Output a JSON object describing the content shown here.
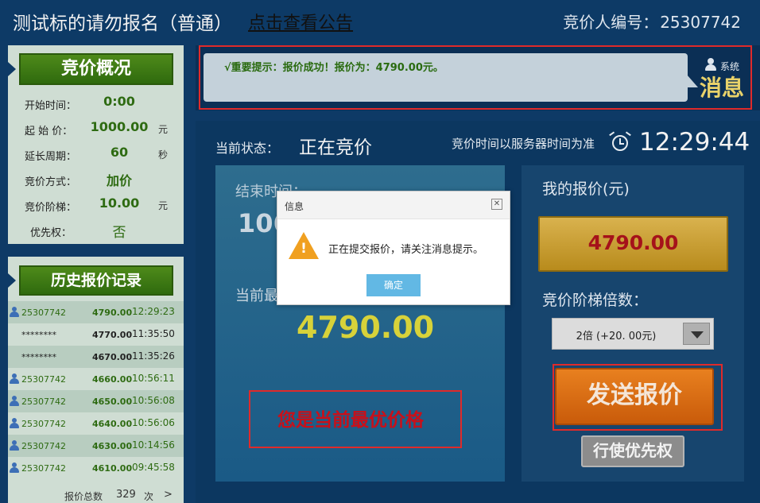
{
  "header": {
    "title": "测试标的请勿报名（普通）",
    "announcement_link": "点击查看公告",
    "bidder_label": "竞价人编号：",
    "bidder_id": "25307742"
  },
  "summary": {
    "title": "竞价概况",
    "rows": [
      {
        "label": "开始时间：",
        "value": "0:00",
        "unit": ""
      },
      {
        "label": "起 始 价：",
        "value": "1000.00",
        "unit": "元"
      },
      {
        "label": "延长周期：",
        "value": "60",
        "unit": "秒"
      },
      {
        "label": "竞价方式：",
        "value": "加价",
        "unit": ""
      },
      {
        "label": "竞价阶梯：",
        "value": "10.00",
        "unit": "元"
      },
      {
        "label": "优先权：",
        "value": "否",
        "unit": ""
      }
    ]
  },
  "history": {
    "title": "历史报价记录",
    "rows": [
      {
        "bidder": "25307742",
        "price": "4790.00",
        "time": "12:29:23",
        "is_user": true
      },
      {
        "bidder": "********",
        "price": "4770.00",
        "time": "11:35:50",
        "is_user": false
      },
      {
        "bidder": "********",
        "price": "4670.00",
        "time": "11:35:26",
        "is_user": false
      },
      {
        "bidder": "25307742",
        "price": "4660.00",
        "time": "10:56:11",
        "is_user": true
      },
      {
        "bidder": "25307742",
        "price": "4650.00",
        "time": "10:56:08",
        "is_user": true
      },
      {
        "bidder": "25307742",
        "price": "4640.00",
        "time": "10:56:06",
        "is_user": true
      },
      {
        "bidder": "25307742",
        "price": "4630.00",
        "time": "10:14:56",
        "is_user": true
      },
      {
        "bidder": "25307742",
        "price": "4610.00",
        "time": "09:45:58",
        "is_user": true
      }
    ],
    "footer_label": "报价总数",
    "footer_count": "329",
    "footer_unit": "次",
    "footer_more": ">"
  },
  "message": {
    "text": "√重要提示：报价成功！报价为：4790.00元。",
    "system_label": "系统",
    "system_title": "消息"
  },
  "status": {
    "label": "当前状态：",
    "value": "正在竞价",
    "server_note": "竞价时间以服务器时间为准",
    "server_time": "12:29:44"
  },
  "center": {
    "end_label": "结束时间：",
    "end_value": "106",
    "best_label": "当前最",
    "best_price": "4790.00",
    "best_msg": "您是当前最优价格"
  },
  "right": {
    "my_bid_label": "我的报价(元)",
    "my_bid_value": "4790.00",
    "ladder_label": "竞价阶梯倍数：",
    "ladder_selected": "2倍 (+20. 00元)",
    "send_label": "发送报价",
    "priority_label": "行使优先权"
  },
  "dialog": {
    "title": "信息",
    "close_glyph": "✕",
    "message": "正在提交报价，请关注消息提示。",
    "ok_label": "确定",
    "warn_glyph": "!"
  },
  "colors": {
    "background": "#0e3a66",
    "accent_green": "#2e6b12",
    "price_yellow": "#d7d23a",
    "alert_red": "#e02a2a",
    "send_orange": "#e8801f"
  }
}
